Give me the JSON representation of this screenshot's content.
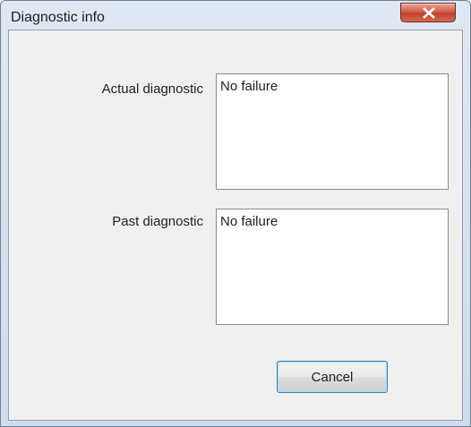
{
  "window": {
    "title": "Diagnostic info"
  },
  "fields": {
    "actual_label": "Actual diagnostic",
    "actual_value": "No failure",
    "past_label": "Past diagnostic",
    "past_value": "No failure"
  },
  "buttons": {
    "cancel_label": "Cancel"
  },
  "icons": {
    "close": "close-icon"
  },
  "colors": {
    "close_button": "#c8452f",
    "window_frame": "#cfdceb",
    "client_background": "#f0f0f0",
    "default_button_border": "#3c7fb1"
  }
}
